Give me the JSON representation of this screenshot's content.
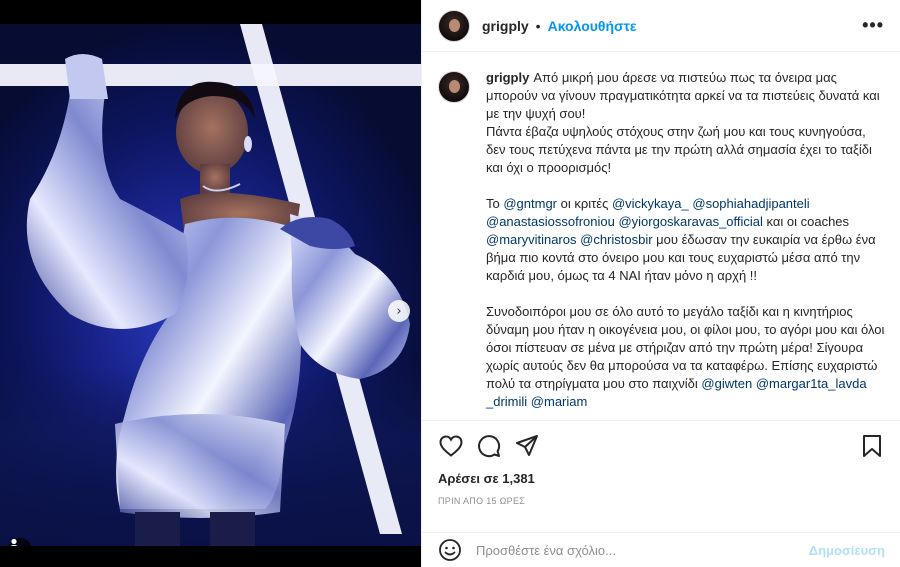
{
  "post": {
    "username": "grigply",
    "follow_label": "Ακολουθήστε",
    "header_separator": "•",
    "more_label": "•••"
  },
  "media": {
    "next_arrow": "›",
    "carousel_count": 2,
    "carousel_active": 1
  },
  "caption": {
    "username": "grigply",
    "p1": "Από μικρή μου άρεσε να πιστεύω πως τα όνειρα μας μπορούν να γίνουν πραγματικότητα αρκεί να τα πιστεύεις δυνατά και με την ψυχή σου!",
    "p2": "Πάντα έβαζα υψηλούς στόχους στην ζωή μου και τους κυνηγούσα, δεν τους πετύχενα πάντα με την πρώτη αλλά σημασία έχει το ταξίδι και όχι ο προορισμός!",
    "p3_a": "Το ",
    "m_gntmgr": "@gntmgr",
    "p3_b": " οι κριτές ",
    "m_vicky": "@vickykaya_",
    "m_sophia": "@sophiahadjipanteli",
    "m_anastasios": "@anastasiossofroniou",
    "m_yiorgos": "@yiorgoskaravas_official",
    "p3_c": " και οι coaches ",
    "m_mary": "@maryvitinaros",
    "m_christos": "@christosbir",
    "p3_d": " μου έδωσαν την ευκαιρία να έρθω ένα βήμα πιο κοντά στο όνειρο μου και τους ευχαριστώ μέσα από την καρδιά μου, όμως τα 4 ΝΑΙ ήταν μόνο η αρχή !!",
    "p4_a": "Συνοδοιπόροι μου σε όλο αυτό το μεγάλο ταξίδι και η κινητήριος δύναμη μου ήταν η οικογένεια μου, οι φίλοι μου, το αγόρι μου και όλοι όσοι πίστευαν σε μένα με στήριζαν από την πρώτη μέρα! Σίγουρα χωρίς αυτούς δεν θα μπορούσα να τα καταφέρω. Επίσης ευχαριστώ πολύ τα στηρίγματα μου στο παιχνίδι ",
    "m_giwten": "@giwten",
    "m_margarita": "@margar1ta_lavda",
    "m_drimili": "_drimili",
    "m_mariam": "@mariam"
  },
  "actions": {
    "likes": "Αρέσει σε 1,381",
    "time": "ΠΡΙΝ ΑΠΟ 15 ΩΡΕΣ"
  },
  "comment": {
    "placeholder": "Προσθέστε ένα σχόλιο...",
    "post_label": "Δημοσίευση"
  },
  "colors": {
    "accent": "#0095f6",
    "mention": "#00376b",
    "post_disabled": "#b2dffc",
    "muted": "#8e8e8e"
  }
}
